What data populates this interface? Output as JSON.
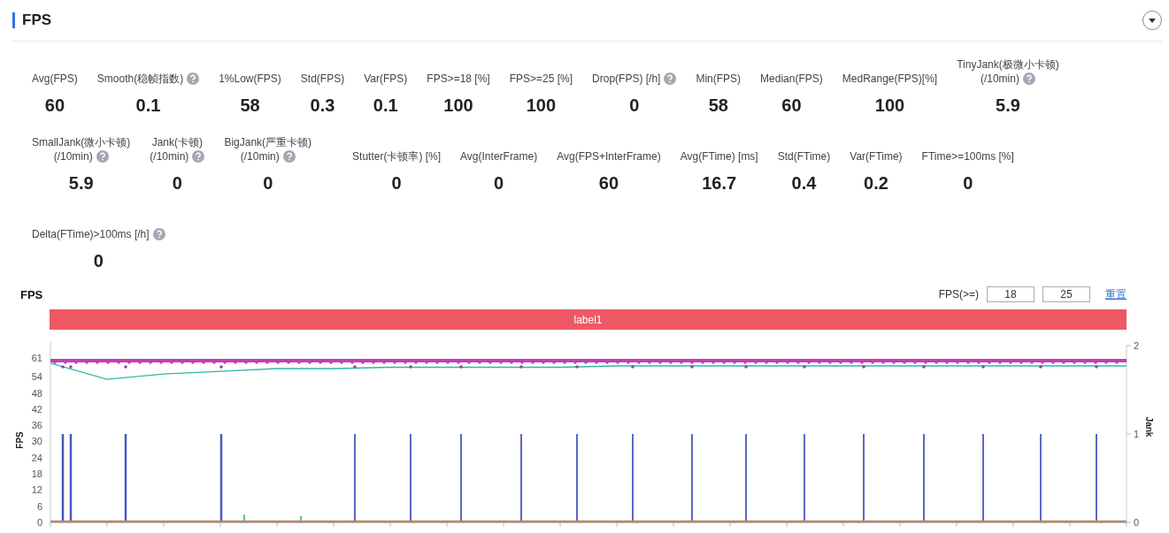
{
  "title": "FPS",
  "metric_rows": [
    [
      {
        "label": "Avg(FPS)",
        "value": "60"
      },
      {
        "label": "Smooth(稳帧指数)",
        "value": "0.1",
        "help": true
      },
      {
        "label": "1%Low(FPS)",
        "value": "58"
      },
      {
        "label": "Std(FPS)",
        "value": "0.3"
      },
      {
        "label": "Var(FPS)",
        "value": "0.1"
      },
      {
        "label": "FPS>=18 [%]",
        "value": "100"
      },
      {
        "label": "FPS>=25 [%]",
        "value": "100"
      },
      {
        "label": "Drop(FPS) [/h]",
        "value": "0",
        "help": true
      },
      {
        "label": "Min(FPS)",
        "value": "58"
      },
      {
        "label": "Median(FPS)",
        "value": "60"
      },
      {
        "label": "MedRange(FPS)[%]",
        "value": "100"
      },
      {
        "label": "TinyJank(极微小卡顿)",
        "sub": "(/10min)",
        "value": "5.9",
        "help": true
      }
    ],
    [
      {
        "label": "SmallJank(微小卡顿)",
        "sub": "(/10min)",
        "value": "5.9",
        "help": true
      },
      {
        "label": "Jank(卡顿)",
        "sub": "(/10min)",
        "value": "0",
        "help": true
      },
      {
        "label": "BigJank(严重卡顿)",
        "sub": "(/10min)",
        "value": "0",
        "help": true
      },
      {
        "label": "Stutter(卡顿率) [%]",
        "value": "0"
      },
      {
        "label": "Avg(InterFrame)",
        "value": "0"
      },
      {
        "label": "Avg(FPS+InterFrame)",
        "value": "60"
      },
      {
        "label": "Avg(FTime) [ms]",
        "value": "16.7"
      },
      {
        "label": "Std(FTime)",
        "value": "0.4"
      },
      {
        "label": "Var(FTime)",
        "value": "0.2"
      },
      {
        "label": "FTime>=100ms [%]",
        "value": "0"
      }
    ],
    [
      {
        "label": "Delta(FTime)>100ms [/h]",
        "value": "0",
        "help": true
      }
    ]
  ],
  "chart": {
    "title": "FPS",
    "threshold_label": "FPS(>=)",
    "thresholds": [
      "18",
      "25"
    ],
    "reset_link": "重置",
    "label_bar": "label1",
    "y2_ticks": [
      "2",
      "1",
      "0"
    ],
    "y2label": "Jank",
    "chart_data": {
      "type": "line",
      "ylabel": "FPS",
      "ylim": [
        0,
        67
      ],
      "yticks": [
        0,
        6,
        12,
        18,
        24,
        30,
        36,
        42,
        48,
        54,
        61
      ],
      "series": [
        {
          "color": "#c23fb4",
          "values": [
            60,
            60,
            60,
            60,
            60,
            60,
            60,
            60,
            60,
            60,
            60,
            60,
            60,
            60,
            60,
            60,
            60,
            60,
            60,
            60
          ]
        },
        {
          "color": "#2fb8a8",
          "values": [
            59,
            53,
            55,
            56,
            57,
            57,
            57.5,
            57.5,
            57.5,
            57.5,
            58,
            58,
            58,
            58,
            58,
            58,
            58,
            58,
            58,
            58
          ]
        }
      ]
    }
  }
}
